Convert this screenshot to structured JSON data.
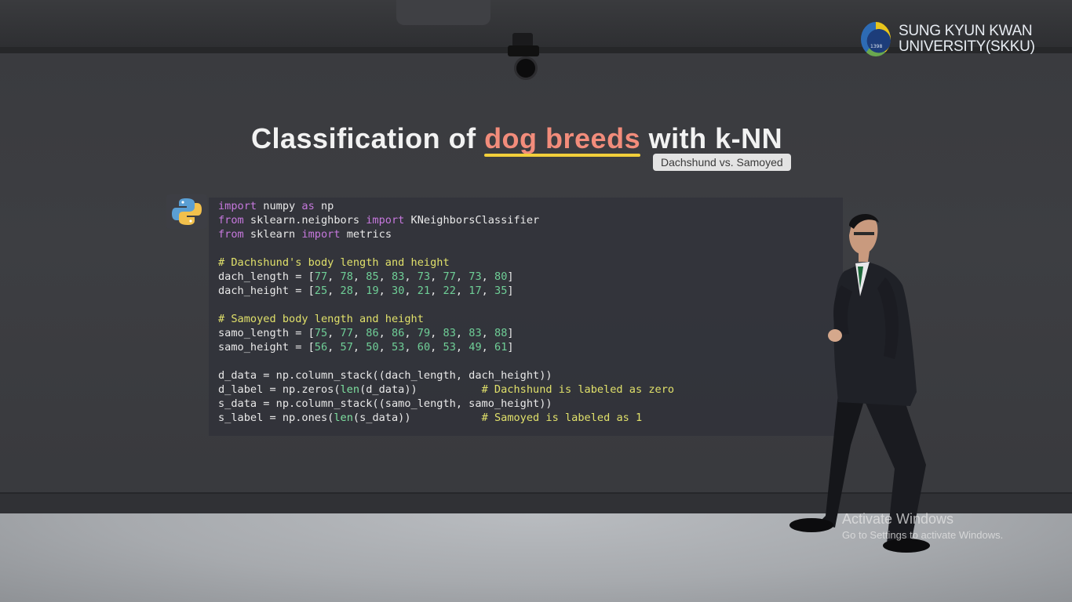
{
  "logo": {
    "line1": "SUNG KYUN KWAN",
    "line2": "UNIVERSITY(SKKU)",
    "year": "1398"
  },
  "slide": {
    "title_prefix": "Classification of ",
    "title_highlight": "dog breeds",
    "title_suffix": " with k-NN",
    "subtitle": "Dachshund vs. Samoyed"
  },
  "code": {
    "language_icon": "python-icon",
    "lines": [
      "import numpy as np",
      "from sklearn.neighbors import KNeighborsClassifier",
      "from sklearn import metrics",
      "",
      "# Dachshund's body length and height",
      "dach_length = [77, 78, 85, 83, 73, 77, 73, 80]",
      "dach_height = [25, 28, 19, 30, 21, 22, 17, 35]",
      "",
      "# Samoyed body length and height",
      "samo_length = [75, 77, 86, 86, 79, 83, 83, 88]",
      "samo_height = [56, 57, 50, 53, 60, 53, 49, 61]",
      "",
      "d_data = np.column_stack((dach_length, dach_height))",
      "d_label = np.zeros(len(d_data))          # Dachshund is labeled as zero",
      "s_data = np.column_stack((samo_length, samo_height))",
      "s_label = np.ones(len(s_data))           # Samoyed is labeled as 1"
    ]
  },
  "watermark": {
    "line1": "Activate Windows",
    "line2": "Go to Settings to activate Windows."
  },
  "colors": {
    "title_highlight": "#f28c7b",
    "underline": "#f2cf3a",
    "keyword": "#c678dd",
    "number": "#6fcf97",
    "comment": "#e0e06a"
  }
}
